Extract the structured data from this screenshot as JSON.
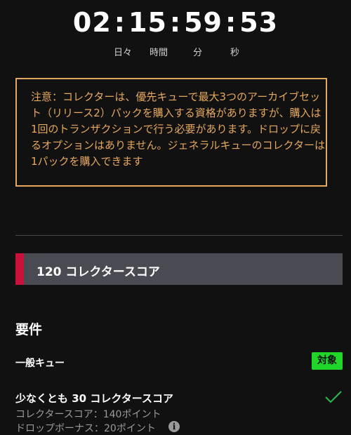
{
  "countdown": {
    "days": "02",
    "hours": "15",
    "minutes": "59",
    "seconds": "53",
    "separator": ":",
    "unit_labels": [
      "日々",
      "時間",
      "分",
      "秒"
    ]
  },
  "notice": {
    "text": "注意：コレクターは、優先キューで最大3つのアーカイブセット（リリース2）パックを購入する資格がありますが、購入は1回のトランザクションで行う必要があります。ドロップに戻るオプションはありません。ジェネラルキューのコレクターは1パックを購入できます"
  },
  "score_bar": {
    "label": "120 コレクタースコア"
  },
  "requirements": {
    "title": "要件",
    "queue_label": "一般キュー",
    "queue_badge": "対象",
    "requirement_line": "少なくとも 30 コレクタースコア",
    "collector_score_detail": "コレクタースコア：140ポイント",
    "drop_bonus_detail": "ドロップボーナス：20ポイント"
  },
  "colors": {
    "background": "#111111",
    "notice_border": "#e6a85e",
    "accent_red": "#c8123c",
    "badge_green": "#21d62b",
    "check_green": "#2bbd4a"
  }
}
